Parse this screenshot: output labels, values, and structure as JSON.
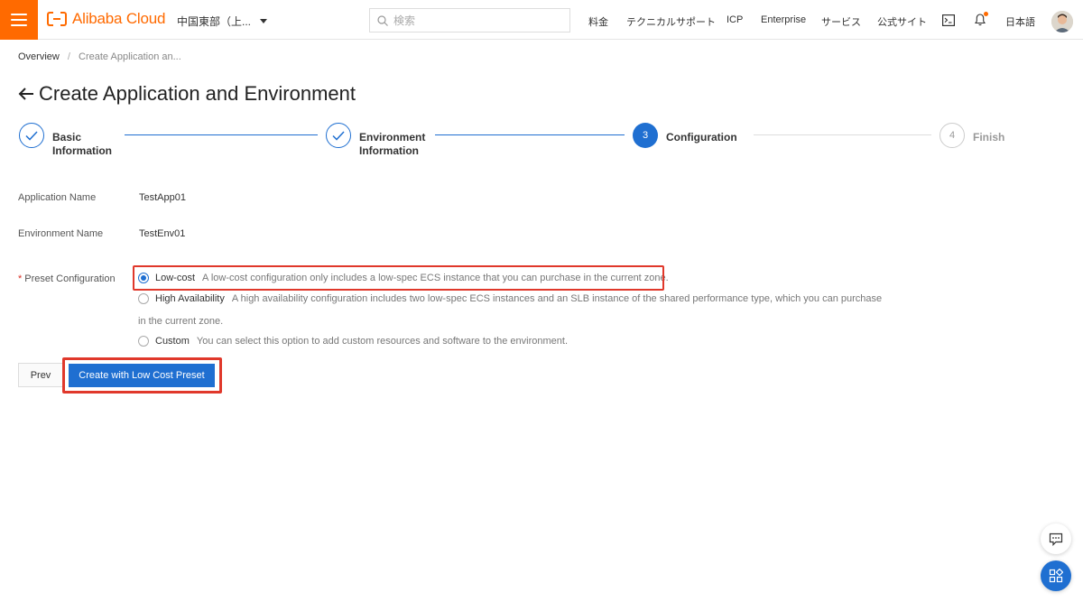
{
  "header": {
    "logo_text": "Alibaba Cloud",
    "region": "中国東部（上...",
    "search_placeholder": "検索",
    "nav": [
      "料金",
      "テクニカルサポート",
      "ICP",
      "Enterprise",
      "サービス",
      "公式サイト"
    ],
    "language": "日本語",
    "icons": {
      "menu": "hamburger-icon",
      "terminal": "terminal-icon",
      "bell": "bell-icon",
      "avatar": "user-avatar",
      "search": "search-icon"
    },
    "brand_color": "#ff6a00"
  },
  "breadcrumb": {
    "items": [
      "Overview",
      "Create Application an..."
    ],
    "separator": "/"
  },
  "page": {
    "title": "Create Application and Environment"
  },
  "steps": [
    {
      "label_line1": "Basic",
      "label_line2": "Information",
      "status": "done"
    },
    {
      "label_line1": "Environment",
      "label_line2": "Information",
      "status": "done"
    },
    {
      "number": "3",
      "label": "Configuration",
      "status": "active"
    },
    {
      "number": "4",
      "label": "Finish",
      "status": "wait"
    }
  ],
  "form": {
    "application_name_label": "Application Name",
    "application_name_value": "TestApp01",
    "environment_name_label": "Environment Name",
    "environment_name_value": "TestEnv01",
    "preset_label": "Preset Configuration",
    "required_mark": "*",
    "options": [
      {
        "name": "Low-cost",
        "desc": "A low-cost configuration only includes a low-spec ECS instance that you can purchase in the current zone.",
        "checked": true
      },
      {
        "name": "High Availability",
        "desc": "A high availability configuration includes two low-spec ECS instances and an SLB instance of the shared performance type, which you can purchase",
        "desc_line2": "in the current zone.",
        "checked": false
      },
      {
        "name": "Custom",
        "desc": "You can select this option to add custom resources and software to the environment.",
        "checked": false
      }
    ]
  },
  "actions": {
    "prev": "Prev",
    "create": "Create with Low Cost Preset"
  },
  "colors": {
    "primary": "#1f6fd1",
    "highlight": "#e0382b",
    "orange": "#ff6a00"
  },
  "floating": {
    "chat_icon": "chat-icon",
    "apps_icon": "apps-grid-icon"
  }
}
